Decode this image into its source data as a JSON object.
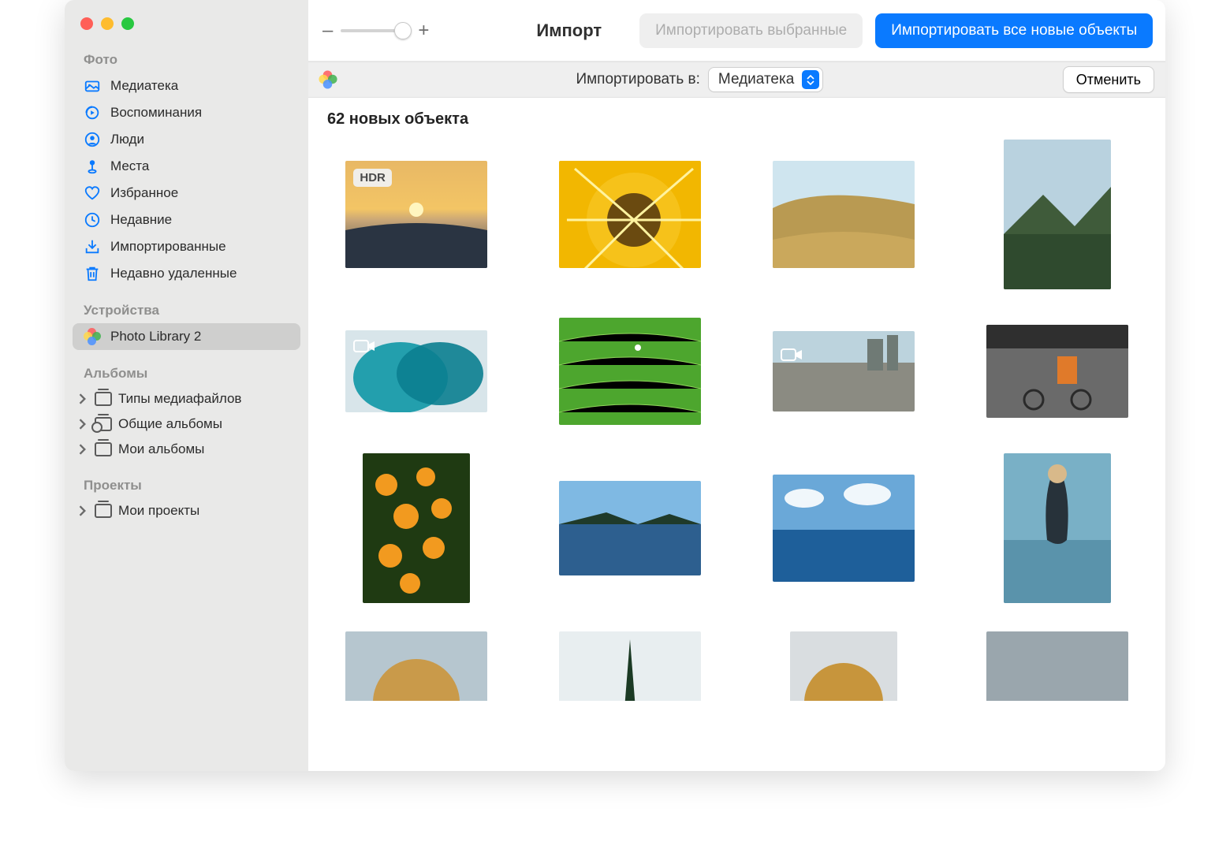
{
  "sidebar": {
    "sections": {
      "photos": {
        "title": "Фото",
        "items": [
          {
            "label": "Медиатека",
            "icon": "library-icon"
          },
          {
            "label": "Воспоминания",
            "icon": "memories-icon"
          },
          {
            "label": "Люди",
            "icon": "people-icon"
          },
          {
            "label": "Места",
            "icon": "places-icon"
          },
          {
            "label": "Избранное",
            "icon": "favorites-icon"
          },
          {
            "label": "Недавние",
            "icon": "recents-icon"
          },
          {
            "label": "Импортированные",
            "icon": "imports-icon"
          },
          {
            "label": "Недавно удаленные",
            "icon": "trash-icon"
          }
        ]
      },
      "devices": {
        "title": "Устройства",
        "items": [
          {
            "label": "Photo Library 2",
            "icon": "photos-app-icon",
            "selected": true
          }
        ]
      },
      "albums": {
        "title": "Альбомы",
        "items": [
          {
            "label": "Типы медиафайлов",
            "icon": "album-icon"
          },
          {
            "label": "Общие альбомы",
            "icon": "shared-album-icon"
          },
          {
            "label": "Мои альбомы",
            "icon": "album-icon"
          }
        ]
      },
      "projects": {
        "title": "Проекты",
        "items": [
          {
            "label": "Мои проекты",
            "icon": "album-icon"
          }
        ]
      }
    }
  },
  "toolbar": {
    "zoom_minus": "–",
    "zoom_plus": "+",
    "title": "Импорт",
    "import_selected": "Импортировать выбранные",
    "import_all": "Импортировать все новые объекты"
  },
  "subbar": {
    "import_to_label": "Импортировать в:",
    "destination": "Медиатека",
    "cancel": "Отменить"
  },
  "content": {
    "heading": "62 новых объекта",
    "thumbnails": [
      {
        "kind": "landscape",
        "badge": "HDR",
        "subject": "sunset-beach"
      },
      {
        "kind": "landscape",
        "subject": "sunflower"
      },
      {
        "kind": "landscape",
        "subject": "rolling-hills"
      },
      {
        "kind": "portrait",
        "subject": "mountain-haze"
      },
      {
        "kind": "landscape",
        "video": true,
        "subject": "blue-smoke"
      },
      {
        "kind": "landscape",
        "subject": "rice-field"
      },
      {
        "kind": "landscape",
        "video": true,
        "subject": "city-wall"
      },
      {
        "kind": "landscape",
        "subject": "garage-bike"
      },
      {
        "kind": "portrait",
        "subject": "orange-flowers"
      },
      {
        "kind": "landscape",
        "subject": "lake-shore"
      },
      {
        "kind": "landscape",
        "subject": "ocean-clouds"
      },
      {
        "kind": "portrait",
        "subject": "boy-water"
      },
      {
        "kind": "landscape",
        "subject": "curly-kid"
      },
      {
        "kind": "landscape",
        "subject": "pine-tree"
      },
      {
        "kind": "landscape",
        "subject": "curly-kid-2"
      },
      {
        "kind": "landscape",
        "subject": "misc"
      }
    ]
  },
  "colors": {
    "accent": "#0a7aff"
  }
}
